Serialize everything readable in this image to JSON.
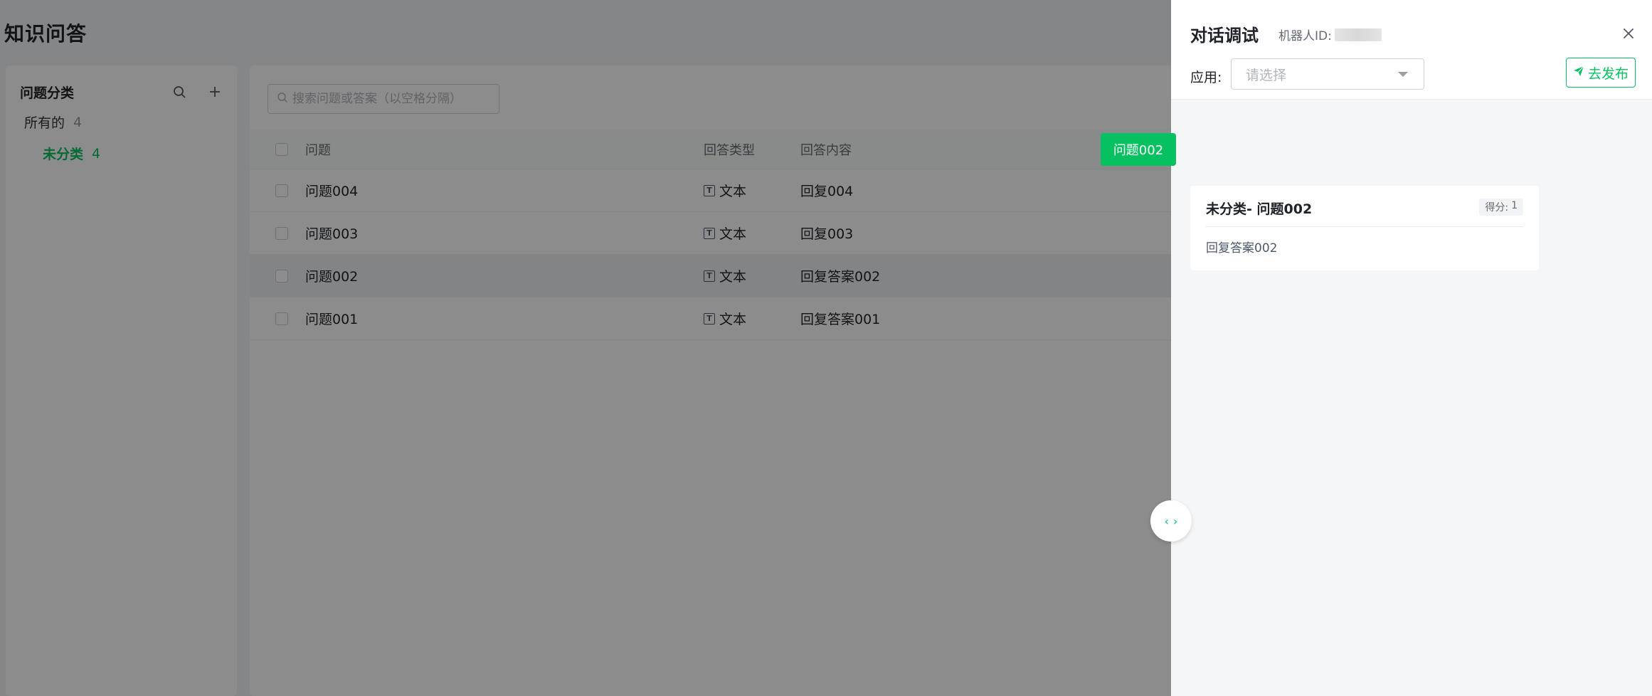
{
  "page": {
    "title": "知识问答"
  },
  "categories": {
    "title": "问题分类",
    "items": [
      {
        "label": "所有的",
        "count": "4"
      },
      {
        "label": "未分类",
        "count": "4"
      }
    ]
  },
  "search": {
    "placeholder": "搜索问题或答案（以空格分隔）"
  },
  "table": {
    "columns": {
      "question": "问题",
      "answer_type": "回答类型",
      "content": "回答内容"
    },
    "rows": [
      {
        "question": "问题004",
        "type": "文本",
        "content": "回复004"
      },
      {
        "question": "问题003",
        "type": "文本",
        "content": "回复003"
      },
      {
        "question": "问题002",
        "type": "文本",
        "content": "回复答案002"
      },
      {
        "question": "问题001",
        "type": "文本",
        "content": "回复答案001"
      }
    ]
  },
  "drawer": {
    "title": "对话调试",
    "bot_id_label": "机器人ID:",
    "bot_id_value": "",
    "app_label": "应用:",
    "app_select_placeholder": "请选择",
    "publish_label": "去发布",
    "user_message": "问题002",
    "reply": {
      "title": "未分类- 问题002",
      "score_label": "得分:",
      "score_value": "1",
      "answer": "回复答案002"
    }
  },
  "colors": {
    "accent": "#07c160",
    "overlay": "rgba(0,0,0,0.45)"
  },
  "icons": [
    "search-icon",
    "plus-icon",
    "close-icon",
    "send-icon",
    "chevron-left-icon",
    "chevron-right-icon",
    "text-type-icon"
  ]
}
